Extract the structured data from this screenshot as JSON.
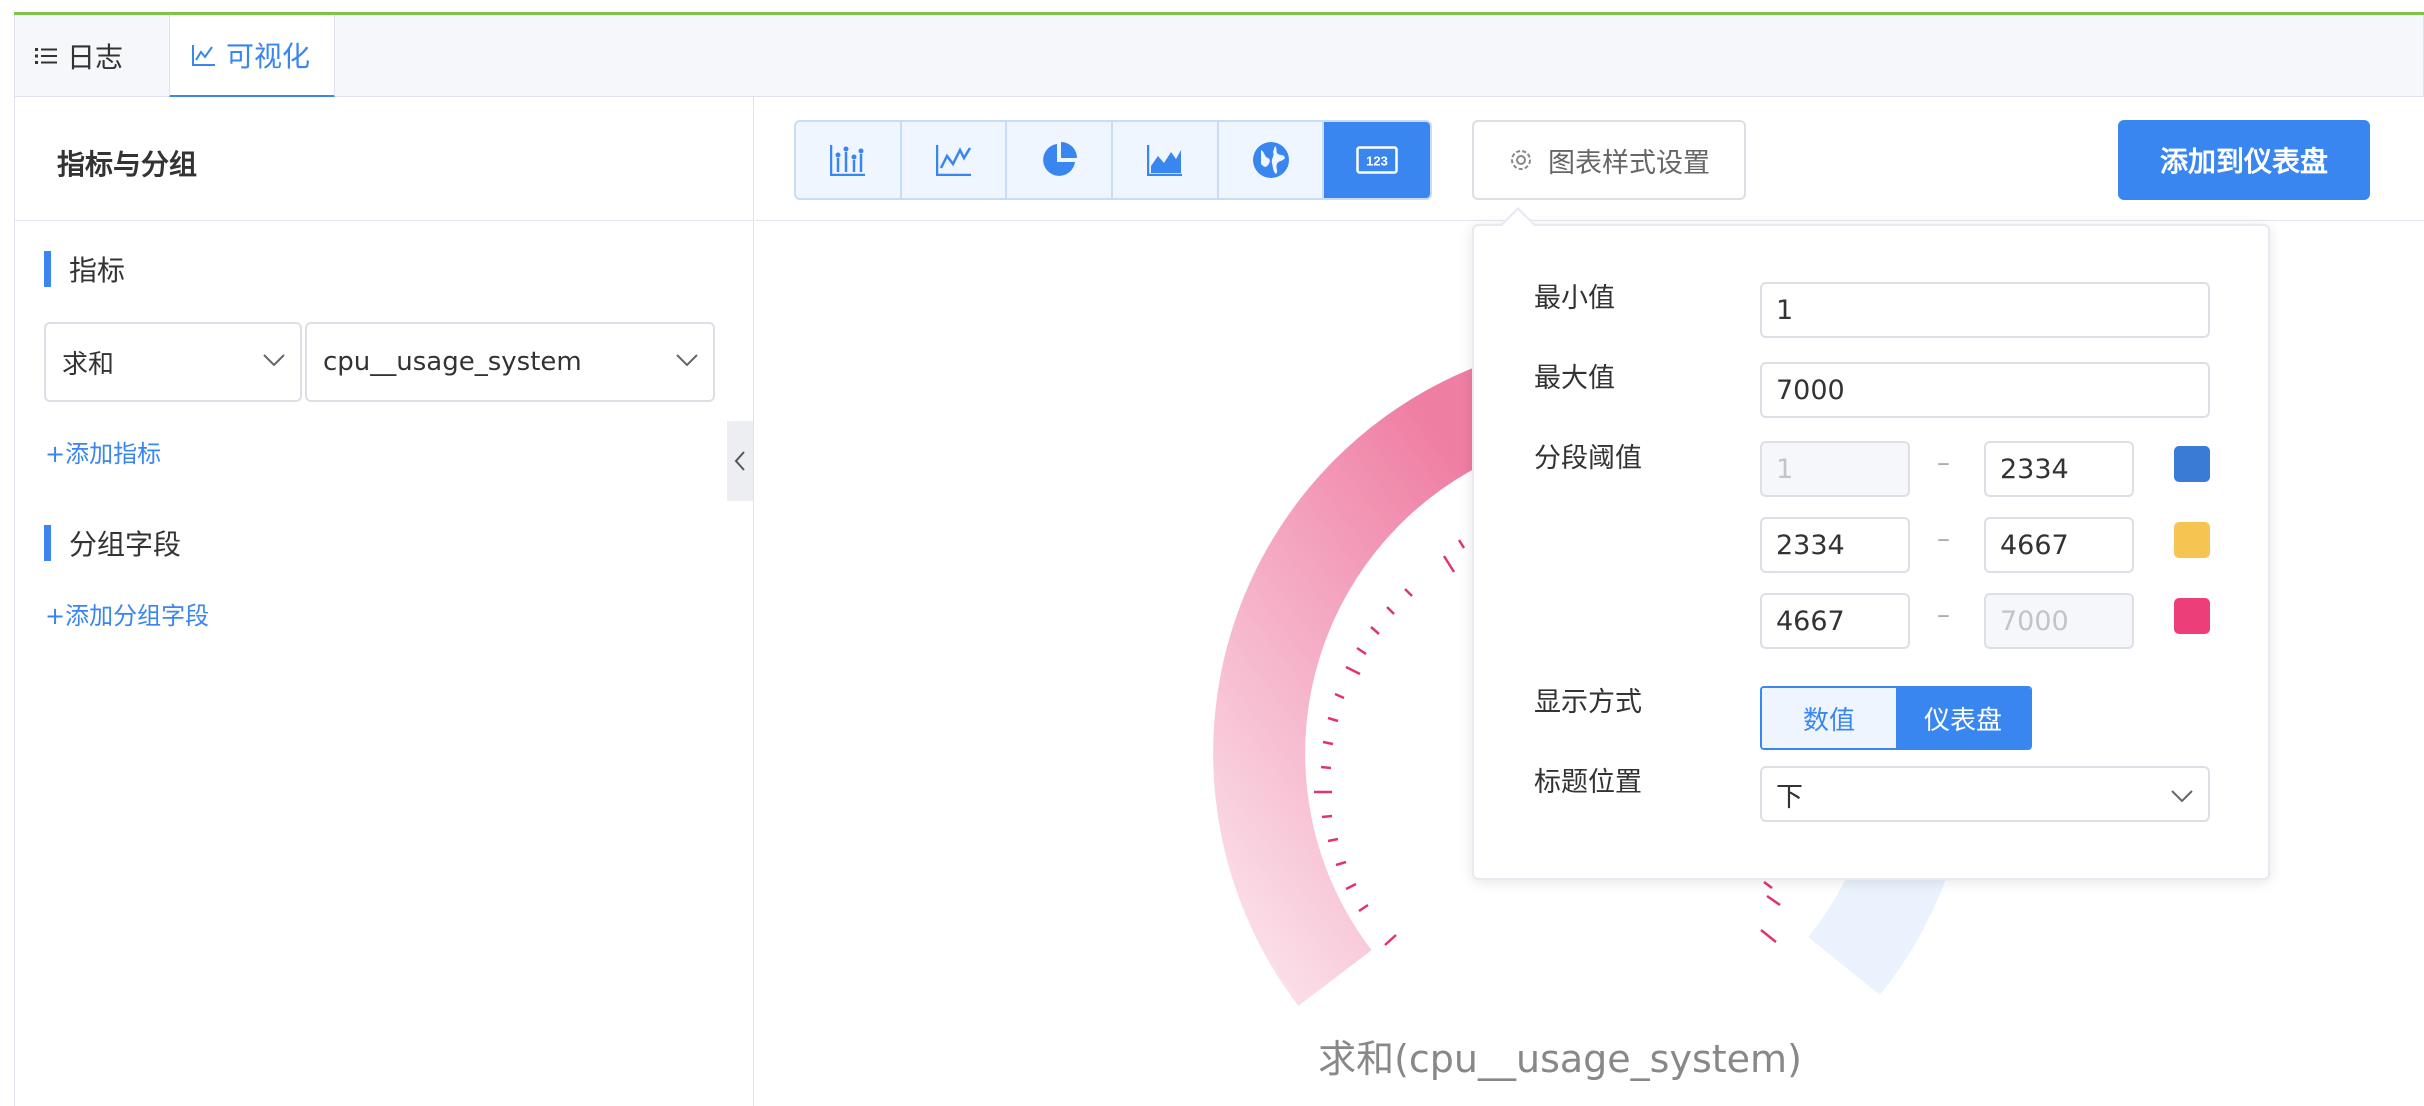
{
  "tabs": {
    "log": "日志",
    "visualize": "可视化"
  },
  "left": {
    "title": "指标与分组",
    "metrics_section": "指标",
    "agg_value": "求和",
    "field_value": "cpu__usage_system",
    "add_metric": "+添加指标",
    "group_section": "分组字段",
    "add_group": "+添加分组字段"
  },
  "toolbar": {
    "chart_types": [
      "bar-chart-icon",
      "line-chart-icon",
      "pie-chart-icon",
      "area-chart-icon",
      "globe-map-icon",
      "number-123-icon"
    ],
    "active_chart": "number-123-icon",
    "style_settings": "图表样式设置",
    "add_to_dashboard": "添加到仪表盘"
  },
  "gauge": {
    "title": "求和(cpu__usage_system)"
  },
  "popover": {
    "min_label": "最小值",
    "min_value": "1",
    "max_label": "最大值",
    "max_value": "7000",
    "threshold_label": "分段阈值",
    "thresholds": [
      {
        "from": "1",
        "to": "2334",
        "color": "#3a7bd5"
      },
      {
        "from": "2334",
        "to": "4667",
        "color": "#f5c451"
      },
      {
        "from": "4667",
        "to": "7000",
        "color": "#ec3f7a"
      }
    ],
    "display_label": "显示方式",
    "display_options": [
      "数值",
      "仪表盘"
    ],
    "display_selected": "仪表盘",
    "title_pos_label": "标题位置",
    "title_pos_value": "下"
  }
}
